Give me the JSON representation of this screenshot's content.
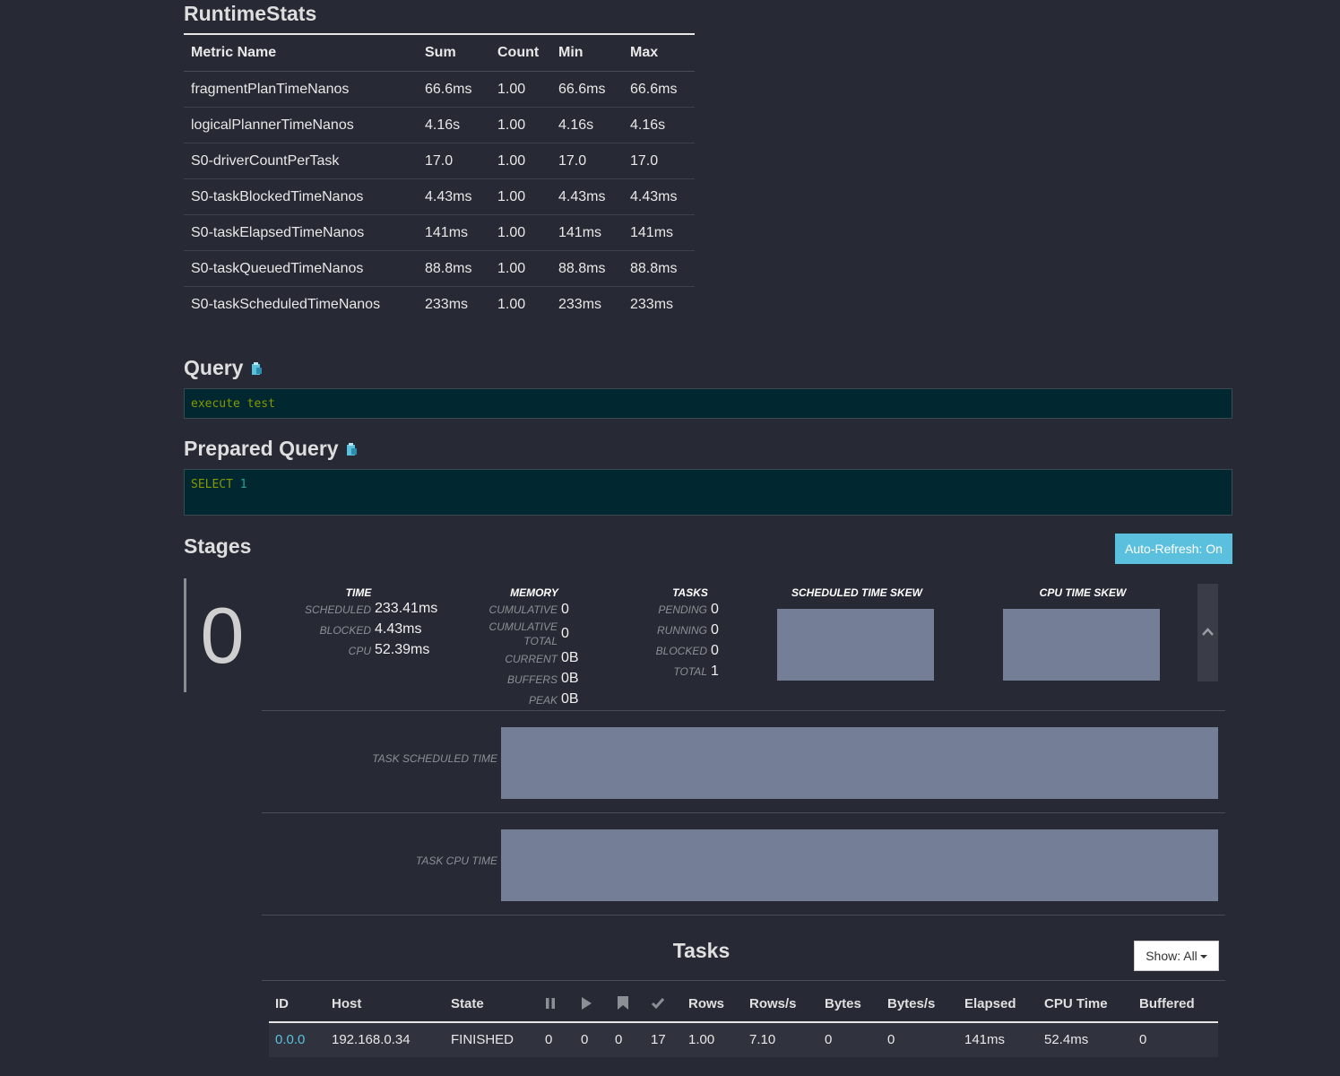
{
  "runtime_stats": {
    "title": "RuntimeStats",
    "columns": [
      "Metric Name",
      "Sum",
      "Count",
      "Min",
      "Max"
    ],
    "rows": [
      [
        "fragmentPlanTimeNanos",
        "66.6ms",
        "1.00",
        "66.6ms",
        "66.6ms"
      ],
      [
        "logicalPlannerTimeNanos",
        "4.16s",
        "1.00",
        "4.16s",
        "4.16s"
      ],
      [
        "S0-driverCountPerTask",
        "17.0",
        "1.00",
        "17.0",
        "17.0"
      ],
      [
        "S0-taskBlockedTimeNanos",
        "4.43ms",
        "1.00",
        "4.43ms",
        "4.43ms"
      ],
      [
        "S0-taskElapsedTimeNanos",
        "141ms",
        "1.00",
        "141ms",
        "141ms"
      ],
      [
        "S0-taskQueuedTimeNanos",
        "88.8ms",
        "1.00",
        "88.8ms",
        "88.8ms"
      ],
      [
        "S0-taskScheduledTimeNanos",
        "233ms",
        "1.00",
        "233ms",
        "233ms"
      ]
    ]
  },
  "query": {
    "title": "Query",
    "text": "execute test"
  },
  "prepared_query": {
    "title": "Prepared Query",
    "keyword": "SELECT",
    "number": "1"
  },
  "stages": {
    "title": "Stages",
    "auto_refresh": "Auto-Refresh: On",
    "stage_id": "0",
    "time": {
      "heading": "TIME",
      "scheduled_label": "SCHEDULED",
      "scheduled": "233.41ms",
      "blocked_label": "BLOCKED",
      "blocked": "4.43ms",
      "cpu_label": "CPU",
      "cpu": "52.39ms"
    },
    "memory": {
      "heading": "MEMORY",
      "cumulative_label": "CUMULATIVE",
      "cumulative": "0",
      "cumulative_total_label_1": "CUMULATIVE",
      "cumulative_total_label_2": "TOTAL",
      "cumulative_total": "0",
      "current_label": "CURRENT",
      "current": "0B",
      "buffers_label": "BUFFERS",
      "buffers": "0B",
      "peak_label": "PEAK",
      "peak": "0B"
    },
    "tasks_summary": {
      "heading": "TASKS",
      "pending_label": "PENDING",
      "pending": "0",
      "running_label": "RUNNING",
      "running": "0",
      "blocked_label": "BLOCKED",
      "blocked": "0",
      "total_label": "TOTAL",
      "total": "1"
    },
    "scheduled_time_skew": "SCHEDULED TIME SKEW",
    "cpu_time_skew": "CPU TIME SKEW",
    "task_scheduled_time": "TASK SCHEDULED TIME",
    "task_cpu_time": "TASK CPU TIME"
  },
  "tasks": {
    "title": "Tasks",
    "show_filter": "Show: All",
    "columns": {
      "id": "ID",
      "host": "Host",
      "state": "State",
      "rows": "Rows",
      "rows_per_sec": "Rows/s",
      "bytes": "Bytes",
      "bytes_per_sec": "Bytes/s",
      "elapsed": "Elapsed",
      "cpu_time": "CPU Time",
      "buffered": "Buffered"
    },
    "icon_columns": [
      "pause-icon",
      "play-icon",
      "bookmark-icon",
      "check-icon"
    ],
    "rows": [
      {
        "id": "0.0.0",
        "host": "192.168.0.34",
        "state": "FINISHED",
        "queued": "0",
        "running": "0",
        "blocked": "0",
        "finished": "17",
        "rows": "1.00",
        "rows_per_sec": "7.10",
        "bytes": "0",
        "bytes_per_sec": "0",
        "elapsed": "141ms",
        "cpu_time": "52.4ms",
        "buffered": "0"
      }
    ]
  },
  "colors": {
    "background": "#272a34",
    "code_bg": "#012830",
    "code_keyword": "#859900",
    "accent": "#5bc0de",
    "bar": "#747f97",
    "link": "#5bc0de"
  }
}
